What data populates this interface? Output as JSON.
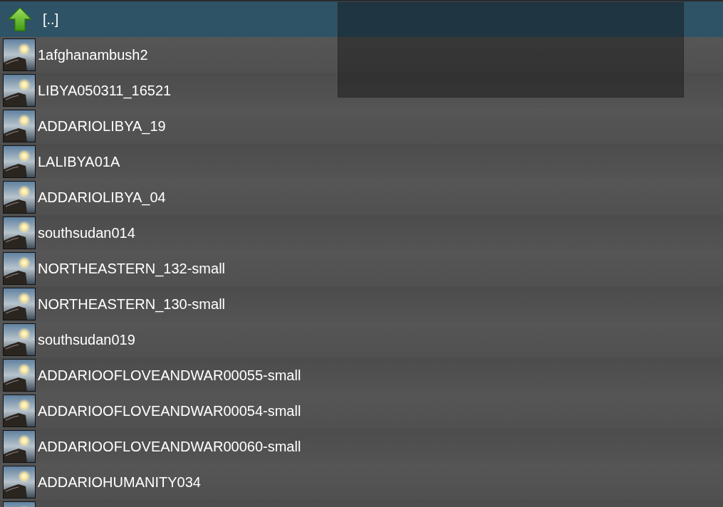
{
  "file_list": [
    {
      "kind": "parent",
      "name": "[..]",
      "selected": true
    },
    {
      "kind": "image",
      "name": "1afghanambush2",
      "selected": false
    },
    {
      "kind": "image",
      "name": "LIBYA050311_16521",
      "selected": false
    },
    {
      "kind": "image",
      "name": "ADDARIOLIBYA_19",
      "selected": false
    },
    {
      "kind": "image",
      "name": "LALIBYA01A",
      "selected": false
    },
    {
      "kind": "image",
      "name": "ADDARIOLIBYA_04",
      "selected": false
    },
    {
      "kind": "image",
      "name": "southsudan014",
      "selected": false
    },
    {
      "kind": "image",
      "name": "NORTHEASTERN_132-small",
      "selected": false
    },
    {
      "kind": "image",
      "name": "NORTHEASTERN_130-small",
      "selected": false
    },
    {
      "kind": "image",
      "name": "southsudan019",
      "selected": false
    },
    {
      "kind": "image",
      "name": "ADDARIOOFLOVEANDWAR00055-small",
      "selected": false
    },
    {
      "kind": "image",
      "name": "ADDARIOOFLOVEANDWAR00054-small",
      "selected": false
    },
    {
      "kind": "image",
      "name": "ADDARIOOFLOVEANDWAR00060-small",
      "selected": false
    },
    {
      "kind": "image",
      "name": "ADDARIOHUMANITY034",
      "selected": false
    },
    {
      "kind": "image",
      "selected": false
    }
  ],
  "overlay": {
    "shown": true
  }
}
